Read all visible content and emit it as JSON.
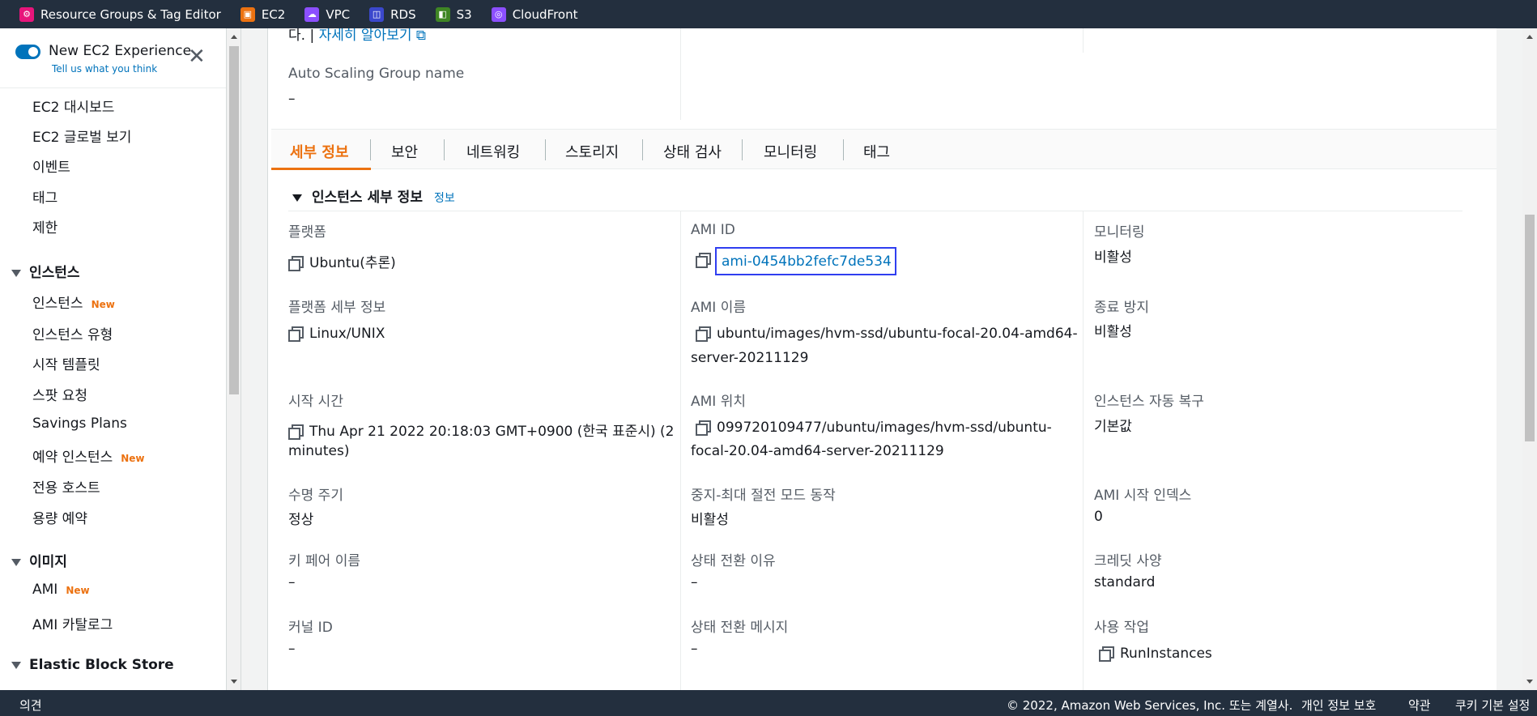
{
  "favorites": [
    {
      "label": "Resource Groups & Tag Editor",
      "color": "#e7157b",
      "icon": "resource-groups-icon"
    },
    {
      "label": "EC2",
      "color": "#ec7211",
      "icon": "ec2-icon"
    },
    {
      "label": "VPC",
      "color": "#8c4fff",
      "icon": "vpc-icon"
    },
    {
      "label": "RDS",
      "color": "#3b48cc",
      "icon": "rds-icon"
    },
    {
      "label": "S3",
      "color": "#3f8624",
      "icon": "s3-icon"
    },
    {
      "label": "CloudFront",
      "color": "#8c4fff",
      "icon": "cloudfront-icon"
    }
  ],
  "sidebar": {
    "toggle_title": "New EC2 Experience",
    "toggle_sub": "Tell us what you think",
    "items": [
      {
        "label": "EC2 대시보드"
      },
      {
        "label": "EC2 글로벌 보기"
      },
      {
        "label": "이벤트"
      },
      {
        "label": "태그"
      },
      {
        "label": "제한"
      }
    ],
    "section_instances": "인스턴스",
    "instances_items": [
      {
        "label": "인스턴스",
        "badge": "New"
      },
      {
        "label": "인스턴스 유형"
      },
      {
        "label": "시작 템플릿"
      },
      {
        "label": "스팟 요청"
      },
      {
        "label": "Savings Plans"
      },
      {
        "label": "예약 인스턴스",
        "badge": "New"
      },
      {
        "label": "전용 호스트"
      },
      {
        "label": "용량 예약"
      }
    ],
    "section_images": "이미지",
    "images_items": [
      {
        "label": "AMI",
        "badge": "New"
      },
      {
        "label": "AMI 카탈로그"
      }
    ],
    "section_ebs": "Elastic Block Store"
  },
  "top_partial": {
    "learn_more_prefix": "다. |",
    "learn_more": "자세히 알아보기",
    "asg_label": "Auto Scaling Group name",
    "asg_value": "–"
  },
  "tabs": [
    "세부 정보",
    "보안",
    "네트워킹",
    "스토리지",
    "상태 검사",
    "모니터링",
    "태그"
  ],
  "details": {
    "section_title": "인스턴스 세부 정보",
    "info": "정보",
    "platform_label": "플랫폼",
    "platform_value": "Ubuntu(추론)",
    "platform_details_label": "플랫폼 세부 정보",
    "platform_details_value": "Linux/UNIX",
    "launch_time_label": "시작 시간",
    "launch_time_line1": "Thu Apr 21 2022 20:18:03 GMT+0900 (한국 표준시) (2",
    "launch_time_line2": "minutes)",
    "lifecycle_label": "수명 주기",
    "lifecycle_value": "정상",
    "keypair_label": "키 페어 이름",
    "keypair_value": "–",
    "kernel_label": "커널 ID",
    "kernel_value": "–",
    "ami_id_label": "AMI ID",
    "ami_id_value": "ami-0454bb2fefc7de534",
    "ami_name_label": "AMI 이름",
    "ami_name_line1": "ubuntu/images/hvm-ssd/ubuntu-focal-20.04-amd64-",
    "ami_name_line2": "server-20211129",
    "ami_location_label": "AMI 위치",
    "ami_location_line1": "099720109477/ubuntu/images/hvm-ssd/ubuntu-",
    "ami_location_line2": "focal-20.04-amd64-server-20211129",
    "stop_hibernate_label": "중지-최대 절전 모드 동작",
    "stop_hibernate_value": "비활성",
    "state_reason_label": "상태 전환 이유",
    "state_reason_value": "–",
    "state_msg_label": "상태 전환 메시지",
    "state_msg_value": "–",
    "monitoring_label": "모니터링",
    "monitoring_value": "비활성",
    "termination_label": "종료 방지",
    "termination_value": "비활성",
    "auto_recovery_label": "인스턴스 자동 복구",
    "auto_recovery_value": "기본값",
    "ami_launch_index_label": "AMI 시작 인덱스",
    "ami_launch_index_value": "0",
    "credit_label": "크레딧 사양",
    "credit_value": "standard",
    "usage_label": "사용 작업",
    "usage_value": "RunInstances"
  },
  "footer": {
    "feedback": "의견",
    "copyright": "© 2022, Amazon Web Services, Inc. 또는 계열사.",
    "privacy": "개인 정보 보호",
    "terms": "약관",
    "cookies": "쿠키 기본 설정"
  }
}
